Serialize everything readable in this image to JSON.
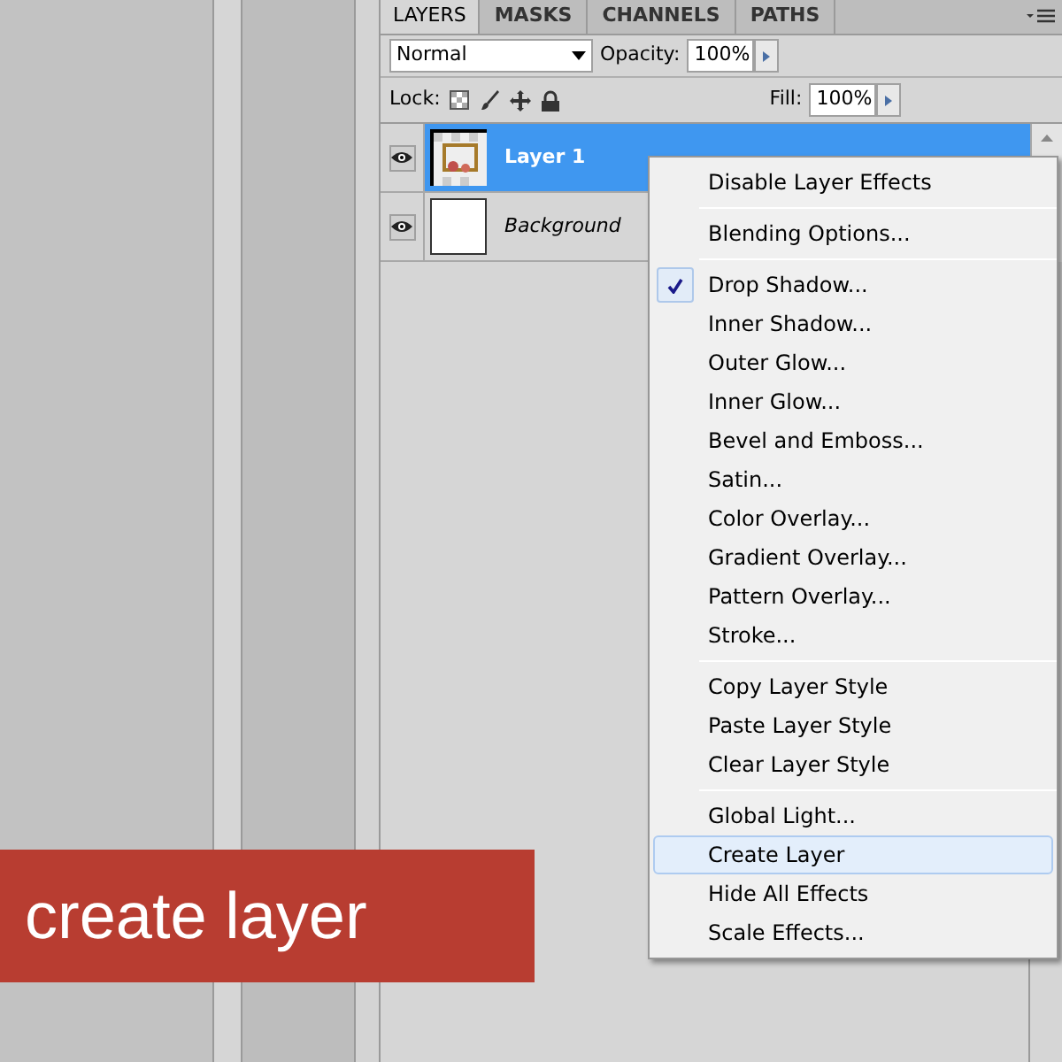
{
  "panel": {
    "tabs": [
      {
        "label": "LAYERS",
        "selected": true
      },
      {
        "label": "MASKS",
        "selected": false
      },
      {
        "label": "CHANNELS",
        "selected": false
      },
      {
        "label": "PATHS",
        "selected": false
      }
    ],
    "blend_mode": "Normal",
    "opacity_label": "Opacity:",
    "opacity": "100%",
    "lock_label": "Lock:",
    "fill_label": "Fill:",
    "fill": "100%",
    "layers": [
      {
        "name": "Layer 1",
        "kind": "layer",
        "visible": true,
        "selected": true
      },
      {
        "name": "Background",
        "kind": "background",
        "visible": true,
        "selected": false
      }
    ]
  },
  "context_menu": {
    "items": [
      {
        "kind": "item",
        "label": "Disable Layer Effects",
        "checked": false,
        "selected": false
      },
      {
        "kind": "separator"
      },
      {
        "kind": "item",
        "label": "Blending Options...",
        "checked": false,
        "selected": false
      },
      {
        "kind": "separator"
      },
      {
        "kind": "item",
        "label": "Drop Shadow...",
        "checked": true,
        "selected": false
      },
      {
        "kind": "item",
        "label": "Inner Shadow...",
        "checked": false,
        "selected": false
      },
      {
        "kind": "item",
        "label": "Outer Glow...",
        "checked": false,
        "selected": false
      },
      {
        "kind": "item",
        "label": "Inner Glow...",
        "checked": false,
        "selected": false
      },
      {
        "kind": "item",
        "label": "Bevel and Emboss...",
        "checked": false,
        "selected": false
      },
      {
        "kind": "item",
        "label": "Satin...",
        "checked": false,
        "selected": false
      },
      {
        "kind": "item",
        "label": "Color Overlay...",
        "checked": false,
        "selected": false
      },
      {
        "kind": "item",
        "label": "Gradient Overlay...",
        "checked": false,
        "selected": false
      },
      {
        "kind": "item",
        "label": "Pattern Overlay...",
        "checked": false,
        "selected": false
      },
      {
        "kind": "item",
        "label": "Stroke...",
        "checked": false,
        "selected": false
      },
      {
        "kind": "separator"
      },
      {
        "kind": "item",
        "label": "Copy Layer Style",
        "checked": false,
        "selected": false
      },
      {
        "kind": "item",
        "label": "Paste Layer Style",
        "checked": false,
        "selected": false
      },
      {
        "kind": "item",
        "label": "Clear Layer Style",
        "checked": false,
        "selected": false
      },
      {
        "kind": "separator"
      },
      {
        "kind": "item",
        "label": "Global Light...",
        "checked": false,
        "selected": false
      },
      {
        "kind": "item",
        "label": "Create Layer",
        "checked": false,
        "selected": true
      },
      {
        "kind": "item",
        "label": "Hide All Effects",
        "checked": false,
        "selected": false
      },
      {
        "kind": "item",
        "label": "Scale Effects...",
        "checked": false,
        "selected": false
      }
    ]
  },
  "caption": "create layer"
}
